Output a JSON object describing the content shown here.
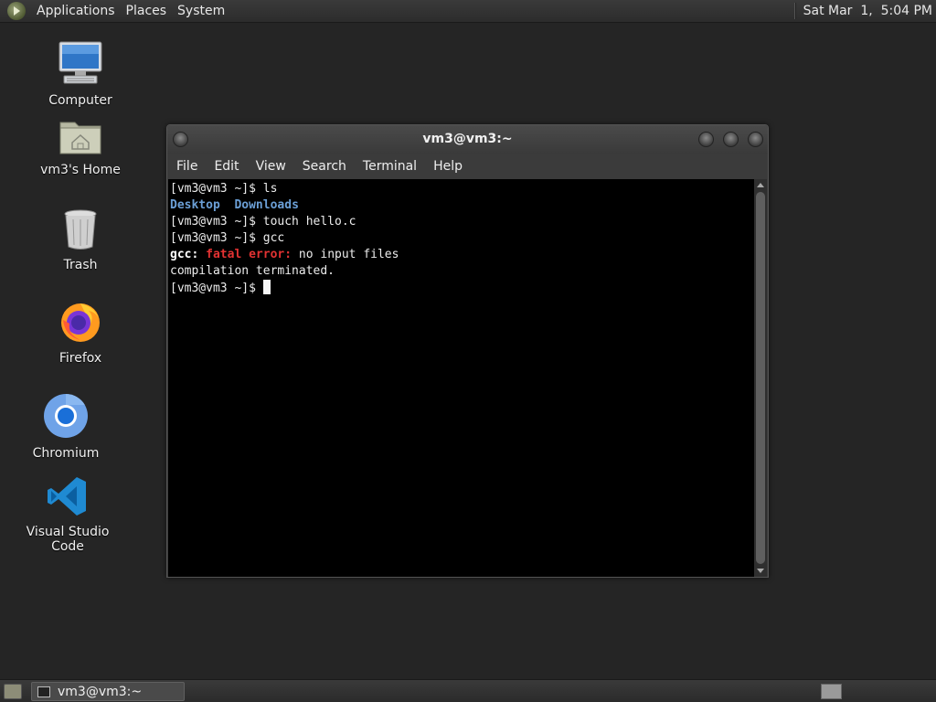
{
  "top_panel": {
    "menus": [
      "Applications",
      "Places",
      "System"
    ],
    "clock": "Sat Mar  1,  5:04 PM"
  },
  "desktop_icons": [
    {
      "label": "Computer",
      "icon": "computer-icon"
    },
    {
      "label": "vm3's Home",
      "icon": "home-folder-icon"
    },
    {
      "label": "Trash",
      "icon": "trash-icon"
    },
    {
      "label": "Firefox",
      "icon": "firefox-icon"
    },
    {
      "label": "Chromium",
      "icon": "chromium-icon"
    },
    {
      "label": "Visual Studio Code",
      "icon": "vscode-icon"
    }
  ],
  "terminal": {
    "title": "vm3@vm3:~",
    "menus": [
      "File",
      "Edit",
      "View",
      "Search",
      "Terminal",
      "Help"
    ],
    "lines": {
      "l1": "[vm3@vm3 ~]$ ls",
      "l2_a": "Desktop",
      "l2_b": "Downloads",
      "l3": "[vm3@vm3 ~]$ touch hello.c",
      "l4": "[vm3@vm3 ~]$ gcc",
      "l5_a": "gcc:",
      "l5_b": "fatal error:",
      "l5_c": " no input files",
      "l6": "compilation terminated.",
      "l7": "[vm3@vm3 ~]$ "
    },
    "colors": {
      "dir": "#6b9fd6",
      "error": "#e23232"
    }
  },
  "taskbar": {
    "task_label": "vm3@vm3:~"
  }
}
